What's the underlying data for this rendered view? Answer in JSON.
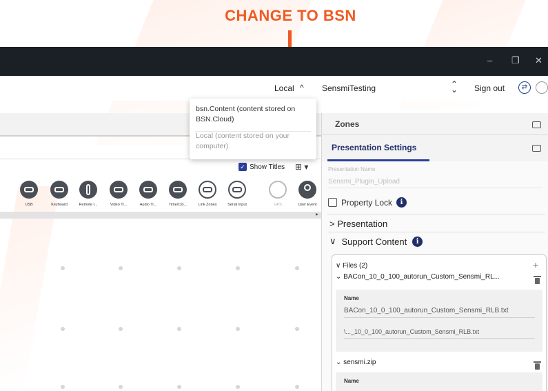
{
  "annotation": {
    "text": "CHANGE TO BSN",
    "color": "#ef5a23"
  },
  "window": {
    "minimize": "–",
    "maximize": "❐",
    "close": "✕"
  },
  "toolbar": {
    "storage_label": "Local",
    "storage_caret": "^",
    "account_name": "SensmiTesting",
    "account_switch": "⌃⌄",
    "sign_out": "Sign out",
    "sync_icon": "sync-icon",
    "globe_icon": "globe-icon"
  },
  "storage_dropdown": {
    "options": [
      {
        "label": "bsn.Content (content stored on BSN.Cloud)"
      },
      {
        "label": "Local (content stored on your computer)"
      }
    ]
  },
  "canvas": {
    "show_titles": "Show Titles",
    "show_titles_checked": true,
    "events": [
      {
        "label": "USB",
        "icon": "usb-icon"
      },
      {
        "label": "Keyboard",
        "icon": "keyboard-icon"
      },
      {
        "label": "Remote I...",
        "icon": "remote-icon"
      },
      {
        "label": "Video Ti...",
        "icon": "video-timecode-icon"
      },
      {
        "label": "Audio Ti...",
        "icon": "audio-timecode-icon"
      },
      {
        "label": "Time/Clo...",
        "icon": "time-clock-icon"
      },
      {
        "label": "Link Zones",
        "icon": "link-zones-icon"
      },
      {
        "label": "Serial Input",
        "icon": "serial-input-icon"
      },
      {
        "label": "GPS",
        "icon": "gps-icon"
      },
      {
        "label": "User Event",
        "icon": "user-event-icon"
      }
    ]
  },
  "right_panel": {
    "zones_label": "Zones",
    "presentation_settings_label": "Presentation Settings",
    "presentation_name_label": "Presentation Name",
    "presentation_name_value": "Sensmi_Plugin_Upload",
    "property_lock_label": "Property Lock",
    "presentation_section": "Presentation",
    "support_content_section": "Support Content",
    "files": {
      "header": "Files (2)",
      "add": "+",
      "items": [
        {
          "title": "BACon_10_0_100_autorun_Custom_Sensmi_RL...",
          "name_label": "Name",
          "name_value": "BACon_10_0_100_autorun_Custom_Sensmi_RLB.txt",
          "path_value": "\\..._10_0_100_autorun_Custom_Sensmi_RLB.txt"
        },
        {
          "title": "sensmi.zip",
          "name_label": "Name"
        }
      ]
    }
  },
  "icons": {
    "chevron_down": "⌄",
    "chevron_right": ">",
    "chevron_open": "∨",
    "info": "i",
    "check": "✓",
    "grid_view": "⊞ ▾",
    "scroll_right": "▸"
  }
}
